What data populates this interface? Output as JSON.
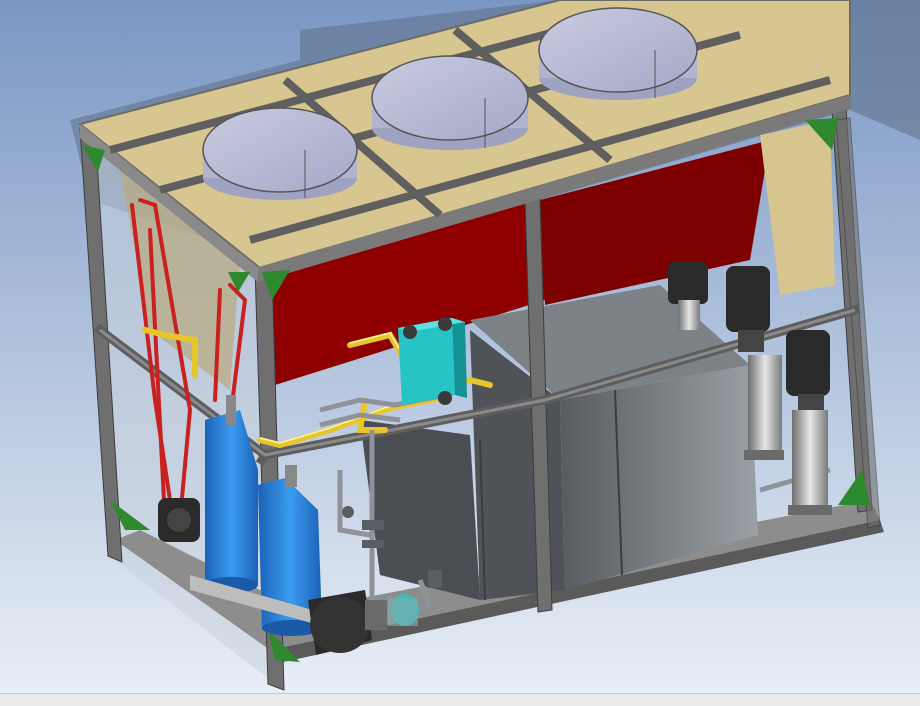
{
  "viewport": {
    "description_icon": "cad-3d-model-chiller-unit",
    "background_top": "#7a97c4",
    "background_bottom": "#e8eef6"
  },
  "model": {
    "frame_color": "#6f6f6f",
    "roof_color": "#d8c690",
    "coil_color": "#8e0000",
    "fan_color": "#b9bdd6",
    "corner_bracket_color": "#2f8a2f",
    "compressor_color": "#2f86d8",
    "plate_hx_color": "#26c4c4",
    "refrigerant_pipe_color": "#c92020",
    "water_pipe_color": "#e7c62a",
    "tank_color": "#8f9499",
    "pump_motor_color": "#2a2a2a",
    "fans": [
      {
        "id": "fan-1"
      },
      {
        "id": "fan-2"
      },
      {
        "id": "fan-3"
      }
    ],
    "pumps": [
      {
        "id": "pump-1"
      },
      {
        "id": "pump-2"
      },
      {
        "id": "pump-3"
      }
    ]
  },
  "status": {}
}
